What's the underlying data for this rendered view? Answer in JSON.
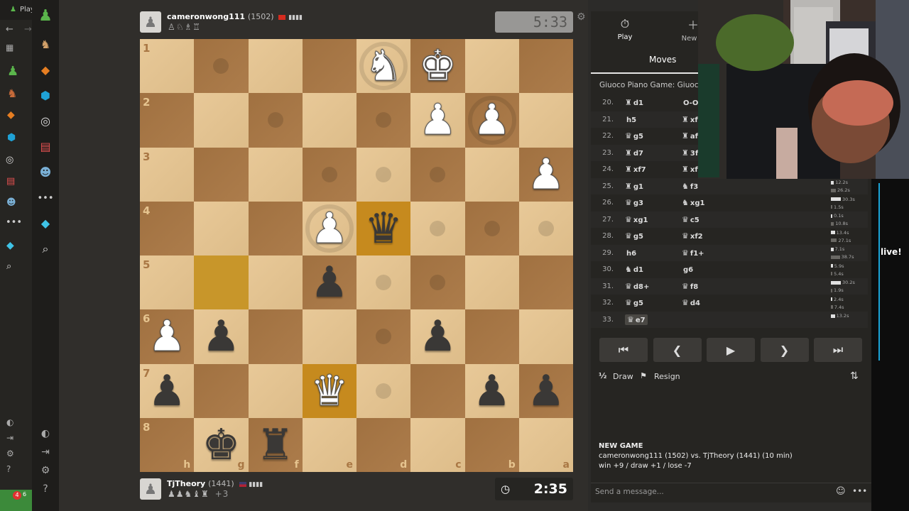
{
  "window": {
    "tab_title": "Play",
    "badge_count": "4",
    "left_time": "6"
  },
  "top_player": {
    "name": "cameronwong111",
    "rating": "(1502)",
    "captured": "♙♘♗♖",
    "clock": "5:33"
  },
  "bottom_player": {
    "name": "TjTheory",
    "rating": "(1441)",
    "captured": "♟♟♞♝♜",
    "advantage": "+3",
    "clock": "2:35"
  },
  "board": {
    "ranks": [
      "1",
      "2",
      "3",
      "4",
      "5",
      "6",
      "7",
      "8"
    ],
    "files": [
      "h",
      "g",
      "f",
      "e",
      "d",
      "c",
      "b",
      "a"
    ],
    "rows": [
      [
        "",
        "",
        "",
        "",
        "wN",
        "wK",
        "",
        ""
      ],
      [
        "",
        "",
        "",
        "",
        "",
        "wP",
        "wP",
        ""
      ],
      [
        "",
        "",
        "",
        "",
        "",
        "",
        "",
        "wP"
      ],
      [
        "",
        "",
        "",
        "wP",
        "bQ",
        "",
        "",
        ""
      ],
      [
        "",
        "",
        "",
        "bP",
        "",
        "",
        "",
        ""
      ],
      [
        "wP",
        "bP",
        "",
        "",
        "",
        "bP",
        "",
        ""
      ],
      [
        "bP",
        "",
        "",
        "wQ",
        "",
        "",
        "bP",
        "bP"
      ],
      [
        "",
        "bK",
        "bR",
        "",
        "",
        "",
        "",
        ""
      ]
    ]
  },
  "tabs": {
    "play": "Play",
    "new_game": "New G",
    "moves": "Moves"
  },
  "opening": "Giuoco Piano Game: Giuoco Pi",
  "moves": [
    {
      "num": "20.",
      "wp": "♜",
      "w": "d1",
      "bp": "",
      "b": "O-O"
    },
    {
      "num": "21.",
      "wp": "",
      "w": "h5",
      "bp": "♜",
      "b": "xf"
    },
    {
      "num": "22.",
      "wp": "♛",
      "w": "g5",
      "bp": "♜",
      "b": "af"
    },
    {
      "num": "23.",
      "wp": "♜",
      "w": "d7",
      "bp": "♜",
      "b": "3f"
    },
    {
      "num": "24.",
      "wp": "♜",
      "w": "xf7",
      "bp": "♜",
      "b": "xf"
    },
    {
      "num": "25.",
      "wp": "♜",
      "w": "g1",
      "bp": "♞",
      "b": "f3"
    },
    {
      "num": "26.",
      "wp": "♛",
      "w": "g3",
      "bp": "♞",
      "b": "xg1"
    },
    {
      "num": "27.",
      "wp": "♛",
      "w": "xg1",
      "bp": "♛",
      "b": "c5"
    },
    {
      "num": "28.",
      "wp": "♛",
      "w": "g5",
      "bp": "♛",
      "b": "xf2"
    },
    {
      "num": "29.",
      "wp": "",
      "w": "h6",
      "bp": "♛",
      "b": "f1+"
    },
    {
      "num": "30.",
      "wp": "♞",
      "w": "d1",
      "bp": "",
      "b": "g6"
    },
    {
      "num": "31.",
      "wp": "♛",
      "w": "d8+",
      "bp": "♛",
      "b": "f8"
    },
    {
      "num": "32.",
      "wp": "♛",
      "w": "g5",
      "bp": "♛",
      "b": "d4"
    },
    {
      "num": "33.",
      "wp": "♛",
      "w": "e7",
      "bp": "",
      "b": ""
    }
  ],
  "move_times": [
    {
      "a": "",
      "aw": 0,
      "b": "",
      "bw": 0
    },
    {
      "a": "",
      "aw": 0,
      "b": "",
      "bw": 0
    },
    {
      "a": "",
      "aw": 0,
      "b": "",
      "bw": 0
    },
    {
      "a": "",
      "aw": 0,
      "b": "",
      "bw": 0
    },
    {
      "a": "",
      "aw": 0,
      "b": "",
      "bw": 0
    },
    {
      "a": "12.2s",
      "aw": 0.3,
      "b": "26.2s",
      "bw": 0.5
    },
    {
      "a": "30.3s",
      "aw": 1.0,
      "b": "1.5s",
      "bw": 0.1
    },
    {
      "a": "0.1s",
      "aw": 0.05,
      "b": "10.8s",
      "bw": 0.3
    },
    {
      "a": "13.4s",
      "aw": 0.4,
      "b": "27.1s",
      "bw": 0.6
    },
    {
      "a": "7.1s",
      "aw": 0.25,
      "b": "38.7s",
      "bw": 0.9
    },
    {
      "a": "5.9s",
      "aw": 0.2,
      "b": "5.4s",
      "bw": 0.15
    },
    {
      "a": "30.2s",
      "aw": 1.0,
      "b": "1.9s",
      "bw": 0.1
    },
    {
      "a": "2.4s",
      "aw": 0.1,
      "b": "7.4s",
      "bw": 0.2
    },
    {
      "a": "13.2s",
      "aw": 0.4,
      "b": "",
      "bw": 0
    }
  ],
  "controls": {
    "first": "⏮",
    "prev": "❮",
    "play": "▶",
    "next": "❯",
    "last": "⏭"
  },
  "actions": {
    "draw_icon": "½",
    "draw": "Draw",
    "resign_icon": "⚑",
    "resign": "Resign",
    "flip": "⇅"
  },
  "new_game": {
    "heading": "NEW GAME",
    "line1": "cameronwong111 (1502) vs. TjTheory (1441) (10 min)",
    "line2": "win +9 / draw +1 / lose -7"
  },
  "chat": {
    "placeholder": "Send a message..."
  },
  "overlay": {
    "live_text": "live!"
  }
}
